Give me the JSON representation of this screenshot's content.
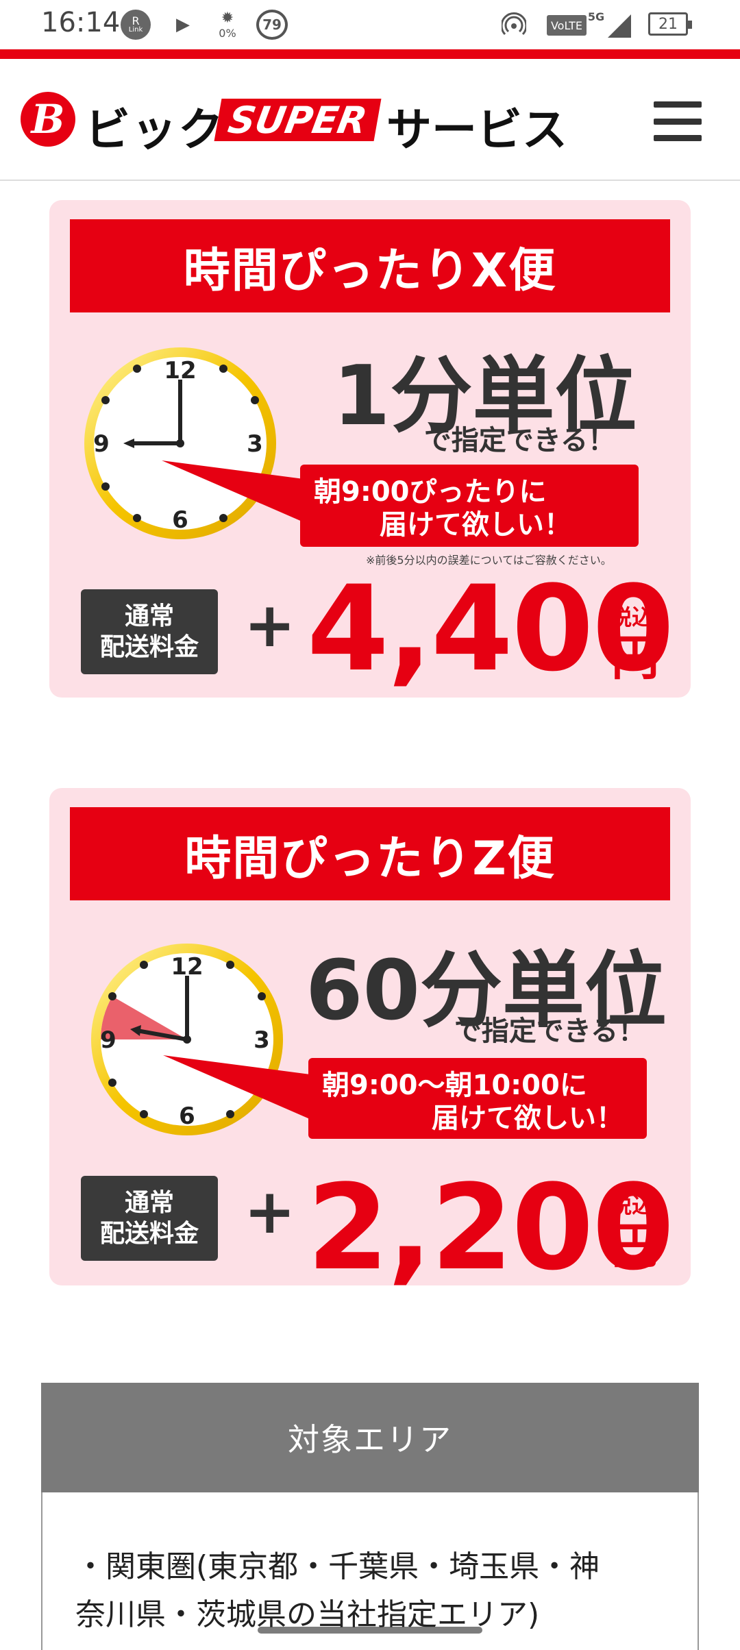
{
  "status_bar": {
    "time": "16:14",
    "rlink_label": "R",
    "rlink_sub": "Link",
    "play_icon": "▶",
    "brightness_value": "0%",
    "badge_count": "79",
    "volte_label": "VoLTE",
    "network_label": "5G",
    "battery_level": "21"
  },
  "header": {
    "logo_mark": "B",
    "logo_text_a": "ビック",
    "logo_super": "SUPER",
    "logo_text_b": "サービス",
    "menu_icon": "hamburger-menu"
  },
  "cards": [
    {
      "banner": "時間ぴったりX便",
      "unit": "1分単位",
      "spec": "で指定できる！",
      "bubble_line1": "朝9:00ぴったりに",
      "bubble_line2": "届けて欲しい！",
      "note": "※前後5分以内の誤差についてはご容赦ください。",
      "fee_label_line1": "通常",
      "fee_label_line2": "配送料金",
      "plus": "+",
      "price": "4,400",
      "tax": "税込",
      "yen": "円",
      "clock_numbers": [
        "12",
        "3",
        "6",
        "9"
      ]
    },
    {
      "banner": "時間ぴったりZ便",
      "unit": "60分単位",
      "spec": "で指定できる！",
      "bubble_line1": "朝9:00～朝10:00に",
      "bubble_line2": "届けて欲しい！",
      "fee_label_line1": "通常",
      "fee_label_line2": "配送料金",
      "plus": "+",
      "price": "2,200",
      "tax": "税込",
      "yen": "円",
      "clock_numbers": [
        "12",
        "3",
        "6",
        "9"
      ]
    }
  ],
  "area": {
    "title": "対象エリア",
    "line1": "・関東圏(東京都・千葉県・埼玉県・神",
    "line2": "奈川県・茨城県の当社指定エリア)"
  },
  "colors": {
    "brand_red": "#e60012",
    "card_pink": "#fde0e6",
    "dark_label": "#3a3a3a",
    "area_gray": "#7a7a7a"
  }
}
